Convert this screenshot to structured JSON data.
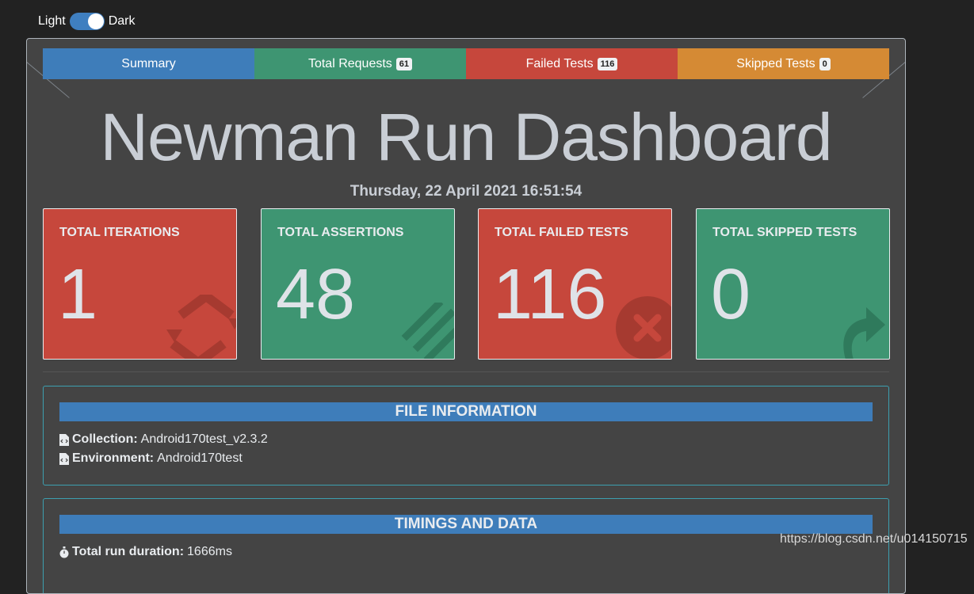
{
  "theme_toggle": {
    "light_label": "Light",
    "dark_label": "Dark",
    "state": "dark"
  },
  "tabs": [
    {
      "label": "Summary",
      "badge": "",
      "color": "#3e7dba"
    },
    {
      "label": "Total Requests",
      "badge": "61",
      "color": "#3e9572"
    },
    {
      "label": "Failed Tests",
      "badge": "116",
      "color": "#c6473c"
    },
    {
      "label": "Skipped Tests",
      "badge": "0",
      "color": "#d58a34"
    }
  ],
  "title": "Newman Run Dashboard",
  "date": "Thursday, 22 April 2021 16:51:54",
  "stats": [
    {
      "label": "TOTAL ITERATIONS",
      "value": "1",
      "color": "#c6473c",
      "icon": "refresh-icon"
    },
    {
      "label": "TOTAL ASSERTIONS",
      "value": "48",
      "color": "#3e9572",
      "icon": "list-check-icon"
    },
    {
      "label": "TOTAL FAILED TESTS",
      "value": "116",
      "color": "#c6473c",
      "icon": "times-circle-icon"
    },
    {
      "label": "TOTAL SKIPPED TESTS",
      "value": "0",
      "color": "#3e9572",
      "icon": "share-arrow-icon"
    }
  ],
  "file_info": {
    "heading": "FILE INFORMATION",
    "collection_label": "Collection:",
    "collection_value": "Android170test_v2.3.2",
    "environment_label": "Environment:",
    "environment_value": "Android170test"
  },
  "timings": {
    "heading": "TIMINGS AND DATA",
    "duration_label": "Total run duration:",
    "duration_value": "1666ms"
  },
  "watermark": "https://blog.csdn.net/u014150715"
}
